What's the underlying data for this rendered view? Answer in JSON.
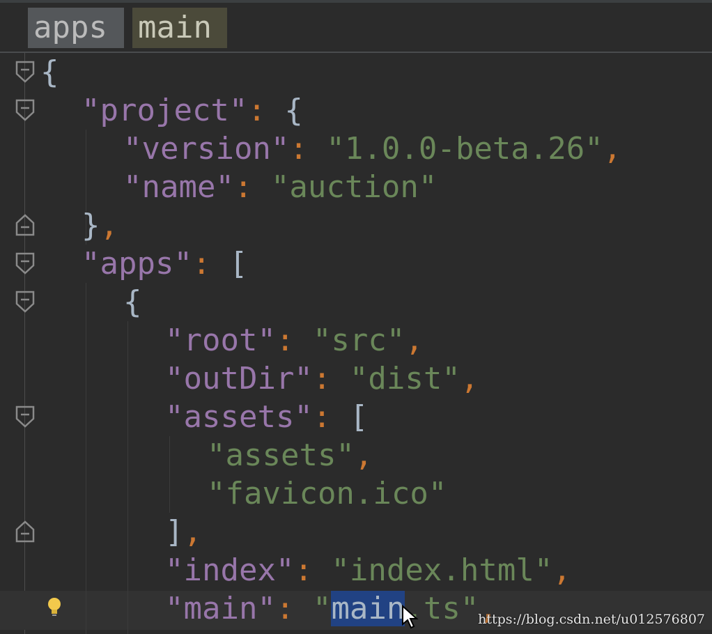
{
  "breadcrumb": {
    "items": [
      "apps",
      "main"
    ]
  },
  "code": {
    "lines": [
      {
        "parts": [
          {
            "t": "{",
            "c": "brace"
          }
        ]
      },
      {
        "parts": [
          {
            "t": "\"project\"",
            "c": "key"
          },
          {
            "t": ": ",
            "c": "punc"
          },
          {
            "t": "{",
            "c": "brace"
          }
        ]
      },
      {
        "parts": [
          {
            "t": "\"version\"",
            "c": "key"
          },
          {
            "t": ": ",
            "c": "punc"
          },
          {
            "t": "\"1.0.0-beta.26\"",
            "c": "str"
          },
          {
            "t": ",",
            "c": "punc"
          }
        ]
      },
      {
        "parts": [
          {
            "t": "\"name\"",
            "c": "key"
          },
          {
            "t": ": ",
            "c": "punc"
          },
          {
            "t": "\"auction\"",
            "c": "str"
          }
        ]
      },
      {
        "parts": [
          {
            "t": "}",
            "c": "brace"
          },
          {
            "t": ",",
            "c": "punc"
          }
        ]
      },
      {
        "parts": [
          {
            "t": "\"apps\"",
            "c": "key"
          },
          {
            "t": ": ",
            "c": "punc"
          },
          {
            "t": "[",
            "c": "brace"
          }
        ]
      },
      {
        "parts": [
          {
            "t": "{",
            "c": "brace"
          }
        ]
      },
      {
        "parts": [
          {
            "t": "\"root\"",
            "c": "key"
          },
          {
            "t": ": ",
            "c": "punc"
          },
          {
            "t": "\"src\"",
            "c": "str"
          },
          {
            "t": ",",
            "c": "punc"
          }
        ]
      },
      {
        "parts": [
          {
            "t": "\"outDir\"",
            "c": "key"
          },
          {
            "t": ": ",
            "c": "punc"
          },
          {
            "t": "\"dist\"",
            "c": "str"
          },
          {
            "t": ",",
            "c": "punc"
          }
        ]
      },
      {
        "parts": [
          {
            "t": "\"assets\"",
            "c": "key"
          },
          {
            "t": ": ",
            "c": "punc"
          },
          {
            "t": "[",
            "c": "brace"
          }
        ]
      },
      {
        "parts": [
          {
            "t": "\"assets\"",
            "c": "str"
          },
          {
            "t": ",",
            "c": "punc"
          }
        ]
      },
      {
        "parts": [
          {
            "t": "\"favicon.ico\"",
            "c": "str"
          }
        ]
      },
      {
        "parts": [
          {
            "t": "]",
            "c": "brace"
          },
          {
            "t": ",",
            "c": "punc"
          }
        ]
      },
      {
        "parts": [
          {
            "t": "\"index\"",
            "c": "key"
          },
          {
            "t": ": ",
            "c": "punc"
          },
          {
            "t": "\"index.html\"",
            "c": "str"
          },
          {
            "t": ",",
            "c": "punc"
          }
        ]
      },
      {
        "parts": [
          {
            "t": "\"main\"",
            "c": "key"
          },
          {
            "t": ": ",
            "c": "punc"
          },
          {
            "t": "\"",
            "c": "str"
          },
          {
            "t": "main",
            "c": "str sel"
          },
          {
            "t": ".ts\"",
            "c": "str"
          },
          {
            "t": ",",
            "c": "punc"
          }
        ]
      }
    ]
  },
  "icons": {
    "lightbulb": "lightbulb-icon",
    "cursor": "mouse-cursor-icon",
    "fold": "fold-marker-icon"
  },
  "colors": {
    "background": "#2b2b2b",
    "key": "#9876aa",
    "string": "#6a8759",
    "punctuation": "#cc7832",
    "selection": "#214283"
  },
  "watermark": "https://blog.csdn.net/u012576807"
}
